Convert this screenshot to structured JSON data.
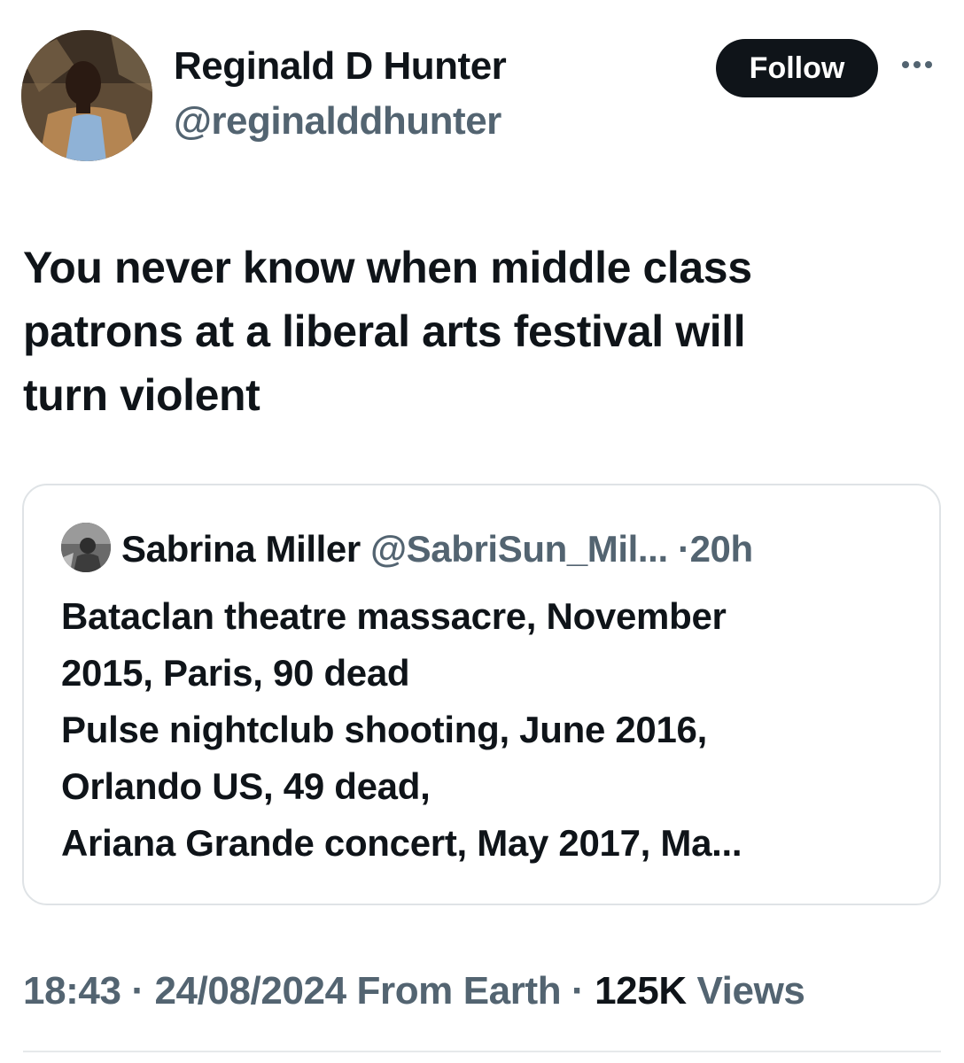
{
  "author": {
    "name": "Reginald D Hunter",
    "handle": "@reginalddhunter"
  },
  "follow_label": "Follow",
  "more_icon": "more-horizontal-icon",
  "tweet": {
    "text": "You never know when middle class\npatrons at a liberal arts festival will\nturn violent"
  },
  "quote": {
    "name": "Sabrina Miller",
    "handle": "@SabriSun_Mil...",
    "separator": "·",
    "time": "20h",
    "text": "Bataclan theatre massacre, November\n2015, Paris, 90 dead\nPulse nightclub shooting, June 2016,\nOrlando US, 49 dead,\nAriana Grande concert, May 2017, Ma..."
  },
  "meta": {
    "time": "18:43",
    "sep1": " · ",
    "date": "24/08/2024",
    "source": " From Earth",
    "sep2": " · ",
    "views_count": "125K",
    "views_label": " Views"
  },
  "colors": {
    "text_primary": "#0f1419",
    "text_secondary": "#536471",
    "border": "#dfe3e6",
    "button_bg": "#0f1419"
  }
}
